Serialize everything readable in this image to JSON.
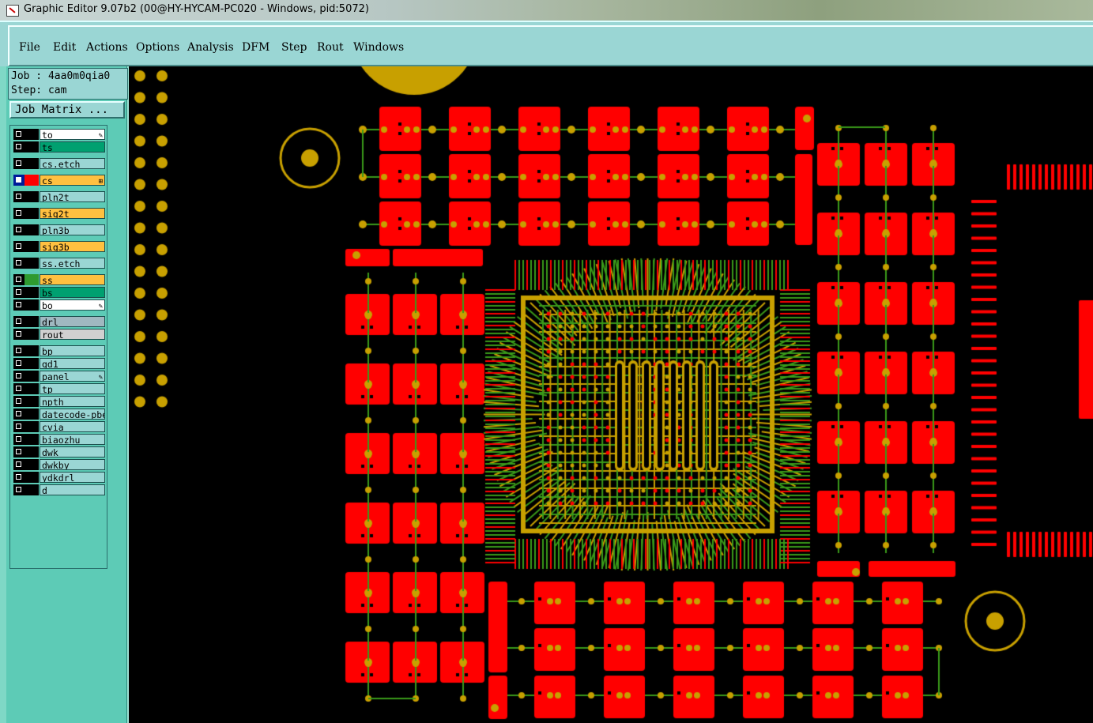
{
  "window": {
    "title": "Graphic Editor 9.07b2 (00@HY-HYCAM-PC020 - Windows, pid:5072)"
  },
  "menu": [
    "File",
    "Edit",
    "Actions",
    "Options",
    "Analysis",
    "DFM",
    "Step",
    "Rout",
    "Windows"
  ],
  "job": {
    "job_line": "Job : 4aa0m0qia0",
    "step_line": "Step: cam"
  },
  "job_matrix_button": "Job Matrix ...",
  "layers": [
    {
      "name": "to",
      "bg": "#ffffff",
      "swatch": "#000000",
      "editable": true
    },
    {
      "name": "ts",
      "bg": "#00a070",
      "swatch": "#000000"
    },
    {
      "name": "cs.etch",
      "bg": "#9ad6d4",
      "swatch": "#000000"
    },
    {
      "name": "cs",
      "bg": "#ffc040",
      "swatch": "#ff0000",
      "selected": true,
      "affected": true
    },
    {
      "name": "pln2t",
      "bg": "#9ad6d4",
      "swatch": "#000000"
    },
    {
      "name": "sig2t",
      "bg": "#ffc040",
      "swatch": "#000000"
    },
    {
      "name": "pln3b",
      "bg": "#9ad6d4",
      "swatch": "#000000"
    },
    {
      "name": "sig3b",
      "bg": "#ffc040",
      "swatch": "#000000"
    },
    {
      "name": "ss.etch",
      "bg": "#9ad6d4",
      "swatch": "#000000"
    },
    {
      "name": "ss",
      "bg": "#ffc040",
      "swatch": "#2f9a2f"
    },
    {
      "name": "bs",
      "bg": "#00a070",
      "swatch": "#000000"
    },
    {
      "name": "bo",
      "bg": "#ffffff",
      "swatch": "#000000",
      "editable": true
    },
    {
      "name": "drl",
      "bg": "#a0b8c0",
      "swatch": "#000000"
    },
    {
      "name": "rout",
      "bg": "#d0d0d0",
      "swatch": "#000000"
    },
    {
      "name": "bp",
      "bg": "#9ad6d4",
      "swatch": "#000000"
    },
    {
      "name": "gd1",
      "bg": "#9ad6d4",
      "swatch": "#000000"
    },
    {
      "name": "panel",
      "bg": "#9ad6d4",
      "swatch": "#000000",
      "editable": true
    },
    {
      "name": "tp",
      "bg": "#9ad6d4",
      "swatch": "#000000"
    },
    {
      "name": "npth",
      "bg": "#9ad6d4",
      "swatch": "#000000"
    },
    {
      "name": "datecode-pbe",
      "bg": "#9ad6d4",
      "swatch": "#000000"
    },
    {
      "name": "cvia",
      "bg": "#9ad6d4",
      "swatch": "#000000"
    },
    {
      "name": "biaozhu",
      "bg": "#9ad6d4",
      "swatch": "#000000"
    },
    {
      "name": "dwk",
      "bg": "#9ad6d4",
      "swatch": "#000000"
    },
    {
      "name": "dwkby",
      "bg": "#9ad6d4",
      "swatch": "#000000"
    },
    {
      "name": "ydkdrl",
      "bg": "#9ad6d4",
      "swatch": "#000000"
    },
    {
      "name": "d",
      "bg": "#9ad6d4",
      "swatch": "#000000"
    }
  ],
  "colors": {
    "pad": "#ff0000",
    "trace_yellow": "#c8a000",
    "trace_green": "#3a9a1a",
    "via": "#c8a000",
    "board_bg": "#000000"
  }
}
